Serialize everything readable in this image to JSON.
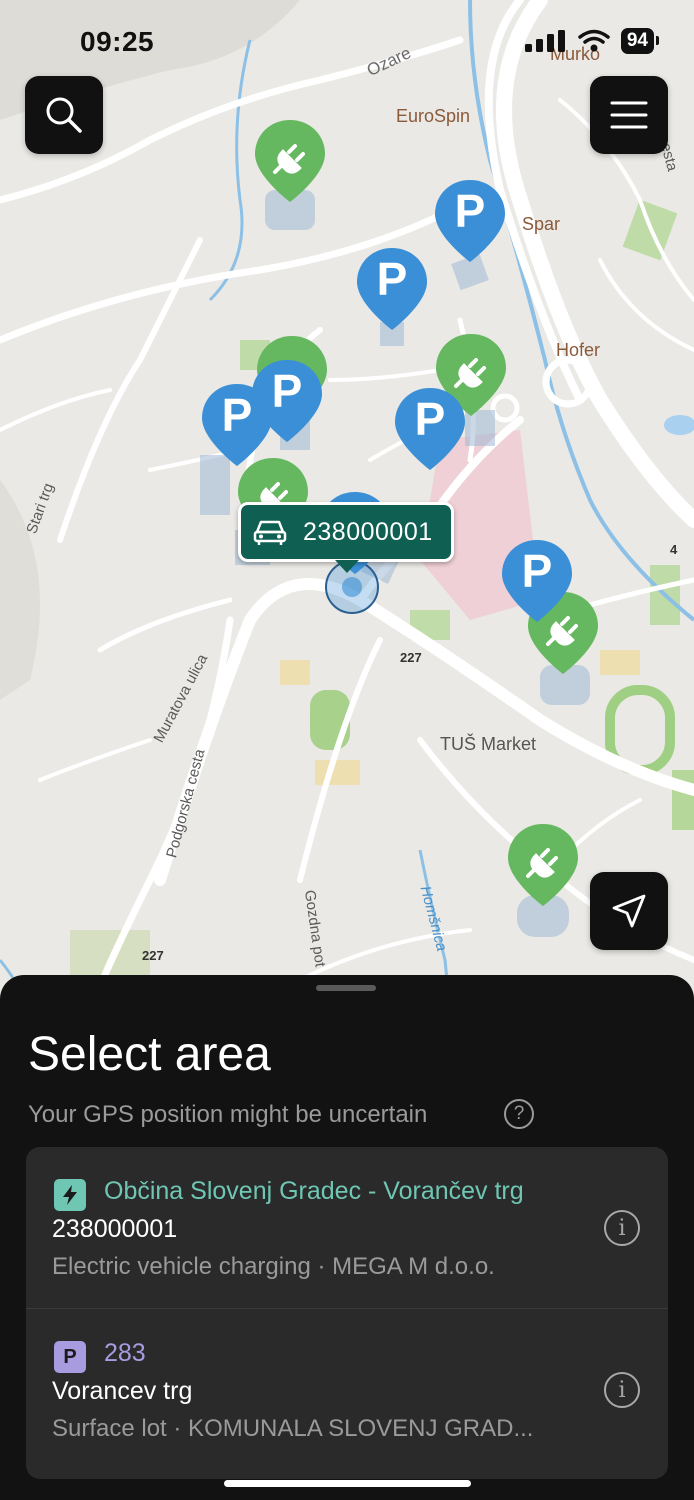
{
  "status_bar": {
    "time": "09:25",
    "battery": "94"
  },
  "map": {
    "labels": {
      "ozare": "Ozare",
      "murko": "Murko",
      "eurospin": "EuroSpin",
      "spar": "Spar",
      "hofer": "Hofer",
      "stari_trg": "Stari trg",
      "muratova": "Muratova ulica",
      "podgorska": "Podgorska cesta",
      "road_227_a": "227",
      "road_227_b": "227",
      "tus": "TUŠ Market",
      "gozdna": "Gozdna pot",
      "homsnica": "Homšnica",
      "cesta": "cesta",
      "road_4": "4"
    },
    "pin_letter": "P",
    "vehicle_tag": {
      "plate": "238000001",
      "icon": "car-icon"
    }
  },
  "buttons": {
    "search": "search-icon",
    "menu": "menu-icon",
    "locate": "navigation-arrow-icon"
  },
  "sheet": {
    "title": "Select area",
    "subtitle": "Your GPS position might be uncertain",
    "help_icon": "?",
    "items": [
      {
        "type": "ev",
        "badge": "lightning-icon",
        "zone": "Občina Slovenj Gradec - Vorančev trg",
        "zone_color": "#6fc7b3",
        "name": "238000001",
        "meta": "Electric vehicle charging · MEGA M d.o.o.",
        "info": "i"
      },
      {
        "type": "parking",
        "badge_letter": "P",
        "zone": "283",
        "zone_color": "#a89be0",
        "name": "Vorancev trg",
        "meta": "Surface lot · KOMUNALA SLOVENJ GRAD...",
        "info": "i"
      }
    ]
  },
  "colors": {
    "parking_pin": "#3a8fd6",
    "ev_pin": "#66b860",
    "vehicle_tag": "#0f5f52",
    "sheet_bg": "#121212"
  }
}
